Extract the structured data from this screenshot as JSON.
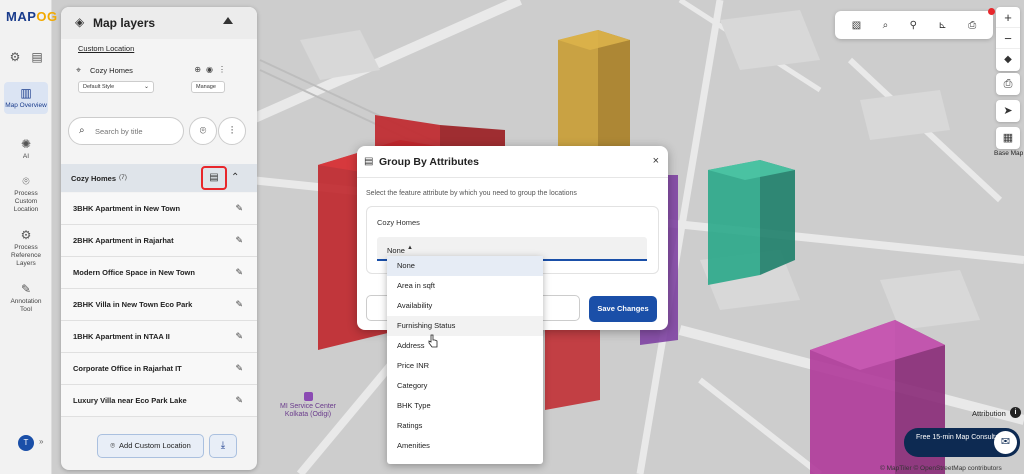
{
  "app": {
    "logo_main": "MAP",
    "logo_accent": "OG"
  },
  "rail": {
    "items": [
      {
        "label": "Map Overview",
        "icon": "map-icon"
      },
      {
        "label": "AI",
        "icon": "ai-icon"
      },
      {
        "label": "Process Custom Location",
        "icon": "location-pin-icon"
      },
      {
        "label": "Process Reference Layers",
        "icon": "gear-icon"
      },
      {
        "label": "Annotation Tool",
        "icon": "pen-icon"
      }
    ],
    "avatar": "T"
  },
  "panel": {
    "title": "Map layers",
    "custom_location": "Custom Location",
    "layer_name": "Cozy Homes",
    "style_value": "Default Style",
    "manage_label": "Manage",
    "search_placeholder": "Search by title",
    "group_name": "Cozy Homes",
    "group_count": "(7)",
    "locations": [
      "3BHK Apartment in New Town",
      "2BHK Apartment in Rajarhat",
      "Modern Office Space in New Town",
      "2BHK Villa in New Town Eco Park",
      "1BHK Apartment in NTAA II",
      "Corporate Office in Rajarhat IT",
      "Luxury Villa near Eco Park Lake"
    ],
    "add_location_label": "Add Custom Location"
  },
  "map": {
    "poi_label": "MI Service Center Kolkata (Odigi)",
    "basemap_label": "Base Map",
    "attribution": "Attribution",
    "consultation": "Free 15-min Map Consultation",
    "copyright": "© MapTiler © OpenStreetMap contributors"
  },
  "modal": {
    "title": "Group By Attributes",
    "description": "Select the feature attribute by which you need to group the locations",
    "card_label": "Cozy Homes",
    "selected_value": "None",
    "save_label": "Save Changes"
  },
  "dropdown": {
    "options": [
      "None",
      "Area in sqft",
      "Availability",
      "Furnishing Status",
      "Address",
      "Price INR",
      "Category",
      "BHK Type",
      "Ratings",
      "Amenities"
    ],
    "selected_index": 0,
    "hover_index": 3
  },
  "colors": {
    "brand": "#1a3c8c",
    "accent": "#f2a900",
    "primary_button": "#1a4fa8",
    "highlight_border": "#e8262b",
    "building_red": "#c0262b",
    "building_orange": "#c89a2a",
    "building_teal": "#2aa88a",
    "building_magenta": "#b03a9a",
    "building_purple": "#7a3aa0"
  }
}
